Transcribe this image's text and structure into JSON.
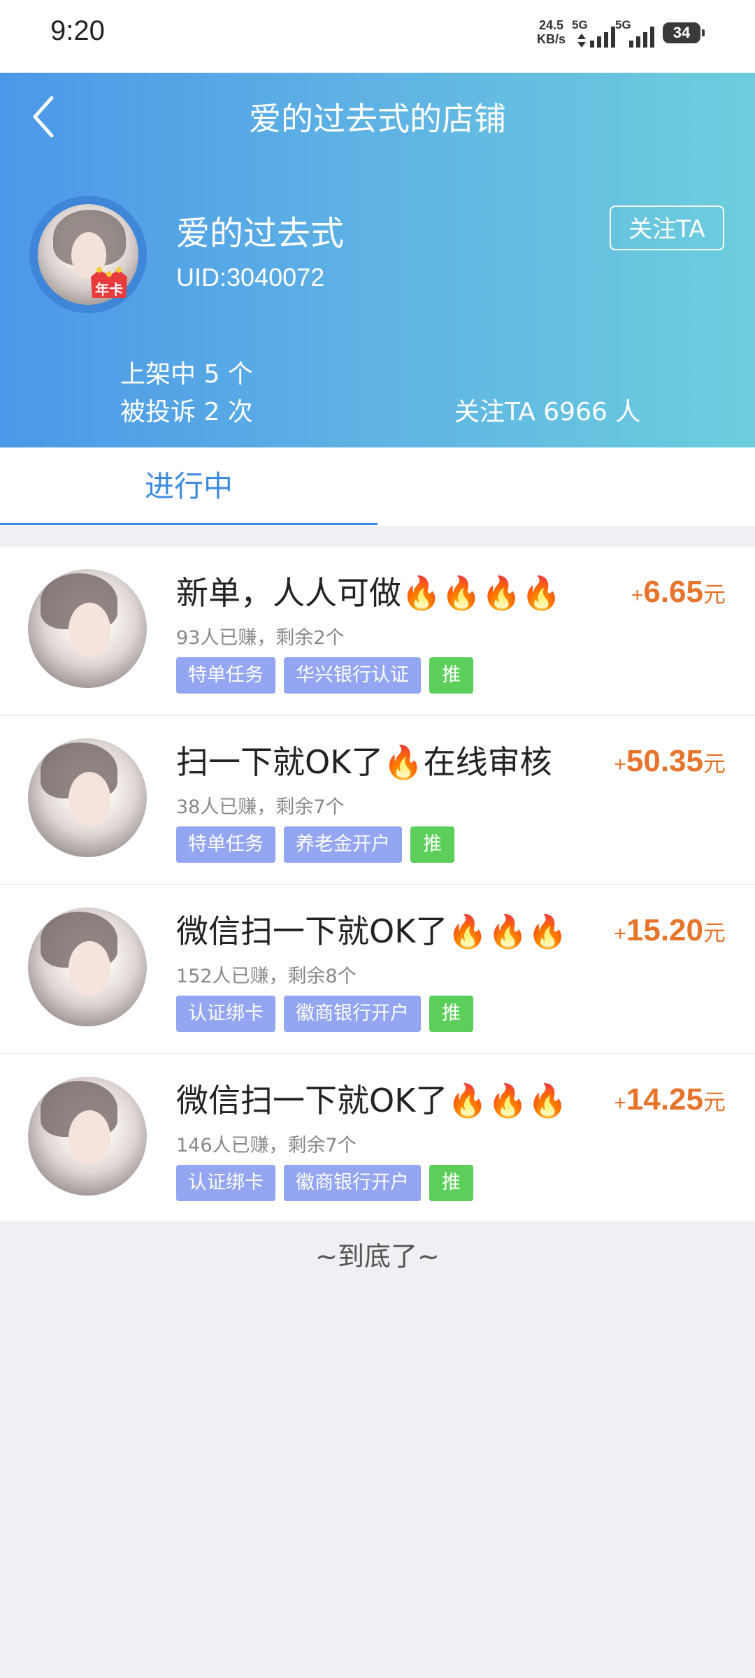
{
  "status_bar": {
    "time": "9:20",
    "net_speed_value": "24.5",
    "net_speed_unit": "KB/s",
    "sim1_label": "5G",
    "sim2_label": "5G",
    "battery": "34"
  },
  "header": {
    "title": "爱的过去式的店铺",
    "shop_name": "爱的过去式",
    "uid": "UID:3040072",
    "follow_button": "关注TA",
    "badge_text": "年卡",
    "listed": "上架中 5 个",
    "complaints": "被投诉 2 次",
    "followers": "关注TA 6966 人",
    "gradient_start": "#4b98e8",
    "gradient_end": "#6ccedd"
  },
  "tabs": [
    {
      "label": "进行中",
      "active": true
    }
  ],
  "tasks": [
    {
      "title": "新单，人人可做🔥🔥🔥🔥",
      "meta": "93人已赚，剩余2个",
      "tags": [
        "特单任务",
        "华兴银行认证"
      ],
      "push_tag": "推",
      "price_prefix": "+",
      "price": "6.65",
      "unit": "元"
    },
    {
      "title": "扫一下就OK了🔥在线审核",
      "meta": "38人已赚，剩余7个",
      "tags": [
        "特单任务",
        "养老金开户"
      ],
      "push_tag": "推",
      "price_prefix": "+",
      "price": "50.35",
      "unit": "元"
    },
    {
      "title": "微信扫一下就OK了🔥🔥🔥",
      "meta": "152人已赚，剩余8个",
      "tags": [
        "认证绑卡",
        "徽商银行开户"
      ],
      "push_tag": "推",
      "price_prefix": "+",
      "price": "15.20",
      "unit": "元"
    },
    {
      "title": "微信扫一下就OK了🔥🔥🔥",
      "meta": "146人已赚，剩余7个",
      "tags": [
        "认证绑卡",
        "徽商银行开户"
      ],
      "push_tag": "推",
      "price_prefix": "+",
      "price": "14.25",
      "unit": "元"
    }
  ],
  "footer": "~到底了~",
  "colors": {
    "accent": "#3d8be0",
    "price": "#e6742b",
    "tag": "#94a5f1",
    "push_tag": "#5ccf5a"
  }
}
